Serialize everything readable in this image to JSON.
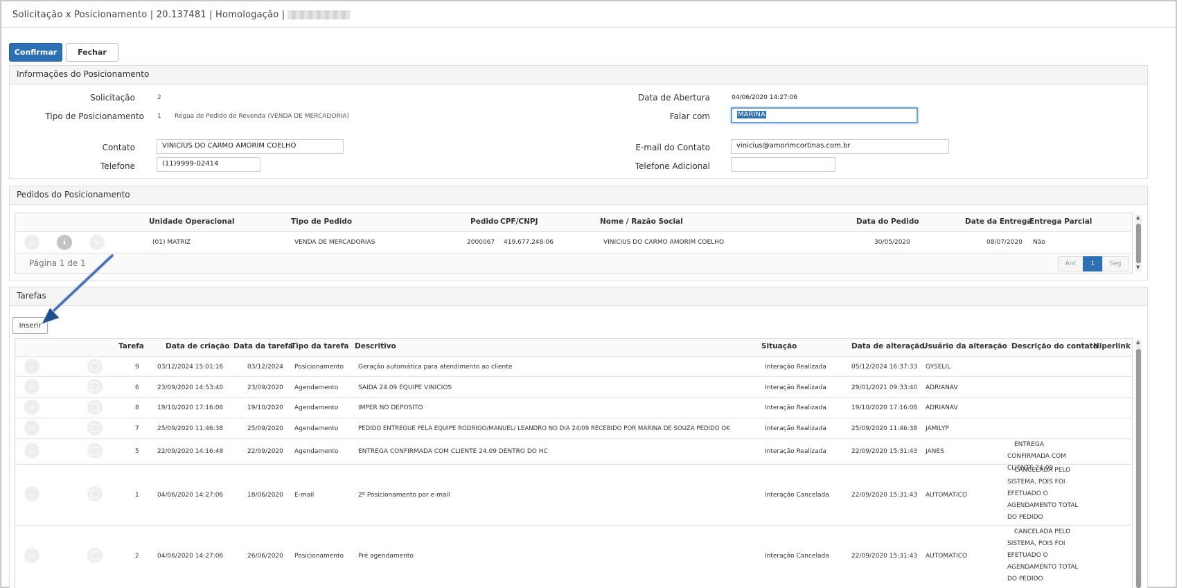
{
  "window": {
    "title": "Solicitação x Posicionamento | 20.137481 | Homologação |"
  },
  "toolbar": {
    "confirm_label": "Confirmar",
    "close_label": "Fechar"
  },
  "info_panel": {
    "heading": "Informações do Posicionamento",
    "solicitacao_label": "Solicitação",
    "solicitacao_value": "2",
    "tipo_label": "Tipo de Posicionamento",
    "tipo_code": "1",
    "tipo_desc": "Régua de Pedido de Revenda (VENDA DE MERCADORIA)",
    "contato_label": "Contato",
    "contato_value": "VINICIUS DO CARMO AMORIM COELHO",
    "telefone_label": "Telefone",
    "telefone_value": "(11)9999-02414",
    "abertura_label": "Data de Abertura",
    "abertura_value": "04/06/2020 14:27:06",
    "falar_label": "Falar com",
    "falar_value": "MARINA",
    "email_label": "E-mail do Contato",
    "email_value": "vinicius@amorimcortinas.com.br",
    "tel_adic_label": "Telefone Adicional",
    "tel_adic_value": ""
  },
  "pedidos_panel": {
    "heading": "Pedidos do Posicionamento",
    "columns": [
      "Unidade Operacional",
      "Tipo de Pedido",
      "Pedido",
      "CPF/CNPJ",
      "Nome / Razão Social",
      "Data do Pedido",
      "Date da Entrega",
      "Entrega Parcial"
    ],
    "rows": [
      [
        "(01) MATRIZ",
        "VENDA DE MERCADORIAS",
        "2000067",
        "419.677.248-06",
        "VINICIUS DO CARMO AMORIM COELHO",
        "30/05/2020",
        "08/07/2020",
        "Não"
      ]
    ],
    "page_text": "Página 1 de 1",
    "prev_label": "Ant",
    "page_number": "1",
    "next_label": "Seg"
  },
  "tarefas_panel": {
    "heading": "Tarefas",
    "insert_label": "Inserir",
    "columns": [
      "Tarefa",
      "Data de criação",
      "Data da tarefa",
      "Tipo da tarefa",
      "Descritivo",
      "Situação",
      "Data de alteração",
      "Usuário da alteração",
      "Descrição do contato",
      "Hiperlink"
    ],
    "rows": [
      [
        "9",
        "03/12/2024 15:01:16",
        "03/12/2024",
        "Posicionamento",
        "Geração automática para atendimento ao cliente",
        "Interação Realizada",
        "05/12/2024 16:37:33",
        "GYSELIL",
        ""
      ],
      [
        "6",
        "23/09/2020 14:53:40",
        "23/09/2020",
        "Agendamento",
        "SAIDA 24.09 EQUIPE VINICIOS",
        "Interação Realizada",
        "29/01/2021 09:33:40",
        "ADRIANAV",
        ""
      ],
      [
        "8",
        "19/10/2020 17:16:08",
        "19/10/2020",
        "Agendamento",
        "IMPER NO DEPOSITO",
        "Interação Realizada",
        "19/10/2020 17:16:08",
        "ADRIANAV",
        ""
      ],
      [
        "7",
        "25/09/2020 11:46:38",
        "25/09/2020",
        "Agendamento",
        "PEDIDO ENTREGUE PELA EQUIPE RODRIGO/MANUEL/ LEANDRO NO DIA 24/09 RECEBIDO POR MARINA DE SOUZA PEDIDO OK",
        "Interação Realizada",
        "25/09/2020 11:46:38",
        "JAMILYP",
        ""
      ],
      [
        "5",
        "22/09/2020 14:16:48",
        "22/09/2020",
        "Agendamento",
        "ENTREGA CONFIRMADA COM CLIENTE 24.09 DENTRO DO HC",
        "Interação Realizada",
        "22/09/2020 15:31:43",
        "JANES",
        "ENTREGA CONFIRMADA COM CLIENTE 24.09"
      ],
      [
        "1",
        "04/06/2020 14:27:06",
        "18/06/2020",
        "E-mail",
        "2º Posicionamento por e-mail",
        "Interação Cancelada",
        "22/09/2020 15:31:43",
        "AUTOMATICO",
        "CANCELADA PELO SISTEMA, POIS FOI EFETUADO O AGENDAMENTO TOTAL DO PEDIDO"
      ],
      [
        "2",
        "04/06/2020 14:27:06",
        "26/06/2020",
        "Posicionamento",
        "Pré agendamento",
        "Interação Cancelada",
        "22/09/2020 15:31:43",
        "AUTOMATICO",
        "CANCELADA PELO SISTEMA, POIS FOI EFETUADO O AGENDAMENTO TOTAL DO PEDIDO"
      ]
    ]
  },
  "colors": {
    "primary": "#2d6fb3",
    "arrow": "#1f4f8f"
  }
}
